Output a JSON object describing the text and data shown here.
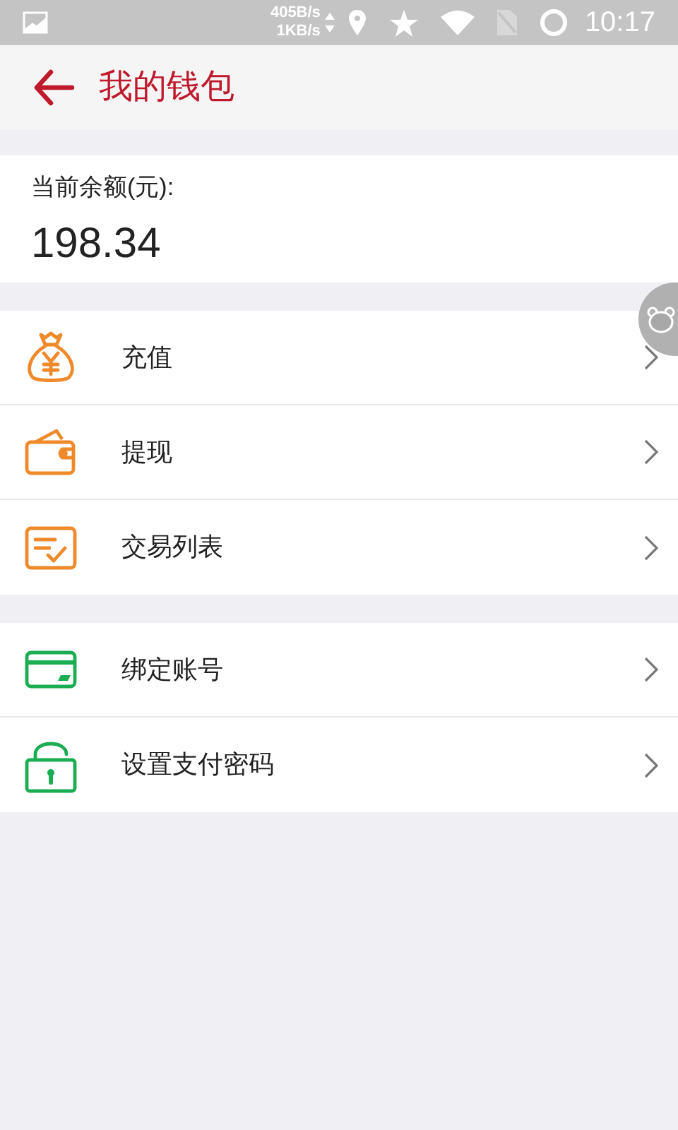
{
  "status_bar": {
    "speed_up": "405B/s",
    "speed_down": "1KB/s",
    "time": "10:17"
  },
  "header": {
    "title": "我的钱包"
  },
  "balance": {
    "label": "当前余额(元):",
    "amount": "198.34"
  },
  "menu_groups": [
    {
      "items": [
        {
          "label": "充值",
          "kind": "moneybag",
          "color": "#f0892a"
        },
        {
          "label": "提现",
          "kind": "wallet",
          "color": "#f0892a"
        },
        {
          "label": "交易列表",
          "kind": "list",
          "color": "#f0892a"
        }
      ]
    },
    {
      "items": [
        {
          "label": "绑定账号",
          "kind": "card",
          "color": "#1aad52"
        },
        {
          "label": "设置支付密码",
          "kind": "lock",
          "color": "#1aad52"
        }
      ]
    }
  ]
}
